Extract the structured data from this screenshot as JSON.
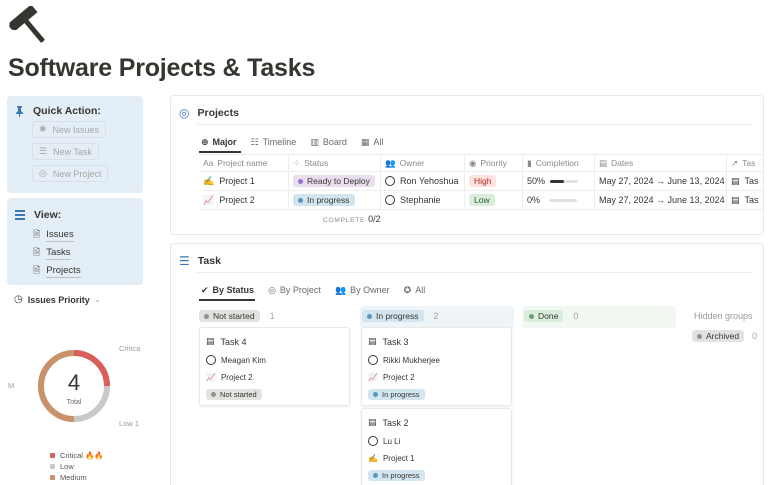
{
  "page": {
    "title": "Software Projects & Tasks",
    "icon": "hammer-icon"
  },
  "quick_action": {
    "heading": "Quick Action:",
    "buttons": [
      {
        "label": "New Issues",
        "icon": "bug-icon"
      },
      {
        "label": "New Task",
        "icon": "checklist-icon"
      },
      {
        "label": "New Project",
        "icon": "target-icon"
      }
    ]
  },
  "view": {
    "heading": "View:",
    "links": [
      {
        "label": "Issues",
        "icon": "bug-page-icon"
      },
      {
        "label": "Tasks",
        "icon": "checklist-page-icon"
      },
      {
        "label": "Projects",
        "icon": "target-page-icon"
      }
    ]
  },
  "issues_priority": {
    "title": "Issues Priority",
    "total": "4",
    "total_label": "Total",
    "labels": [
      "Critica",
      "M",
      "Low 1"
    ],
    "legend": [
      {
        "label": "Critical 🔥🔥",
        "color": "#d95f5a"
      },
      {
        "label": "Low",
        "color": "#c9c9c6"
      },
      {
        "label": "Medium",
        "color": "#c9926a"
      }
    ]
  },
  "projects": {
    "title": "Projects",
    "tabs": [
      "Major",
      "Timeline",
      "Board",
      "All"
    ],
    "columns": [
      "Project name",
      "Status",
      "Owner",
      "Priority",
      "Completion",
      "Dates",
      "Tas"
    ],
    "rows": [
      {
        "emoji": "✍️",
        "name": "Project 1",
        "status": "Ready to Deploy",
        "owner": "Ron Yehoshua",
        "priority": "High",
        "completion": "50%",
        "completion_value": 0.5,
        "dates": "May 27, 2024 → June 13, 2024",
        "tasks": "Tas"
      },
      {
        "emoji": "📈",
        "name": "Project 2",
        "status": "In progress",
        "owner": "Stephanie",
        "priority": "Low",
        "completion": "0%",
        "completion_value": 0,
        "dates": "May 27, 2024 → June 13, 2024",
        "tasks": "Tas"
      }
    ],
    "complete_label": "COMPLETE",
    "complete_value": "0/2"
  },
  "tasks": {
    "title": "Task",
    "tabs": [
      "By Status",
      "By Project",
      "By Owner",
      "All"
    ],
    "groups": [
      {
        "label": "Not started",
        "count": "1"
      },
      {
        "label": "In progress",
        "count": "2"
      },
      {
        "label": "Done",
        "count": "0"
      }
    ],
    "hidden_groups_label": "Hidden groups",
    "archived_label": "Archived",
    "archived_count": "0",
    "cards": [
      {
        "title": "Task 4",
        "owner": "Meagan Kim",
        "project": "Project 2",
        "project_emoji": "📈",
        "status": "Not started"
      },
      {
        "title": "Task 3",
        "owner": "Rikki Mukherjee",
        "project": "Project 2",
        "project_emoji": "📈",
        "status": "In progress"
      },
      {
        "title": "Task 2",
        "owner": "Lu Li",
        "project": "Project 1",
        "project_emoji": "✍️",
        "status": "In progress"
      }
    ]
  },
  "colors": {
    "callout_bg": "#e4eef7",
    "status_ready": "#e8deee",
    "status_progress": "#d3e5ef",
    "status_not_started": "#e3e2e0",
    "status_done": "#dbeddb",
    "priority_high": "#ffe2dd",
    "priority_low": "#dbeddb"
  }
}
